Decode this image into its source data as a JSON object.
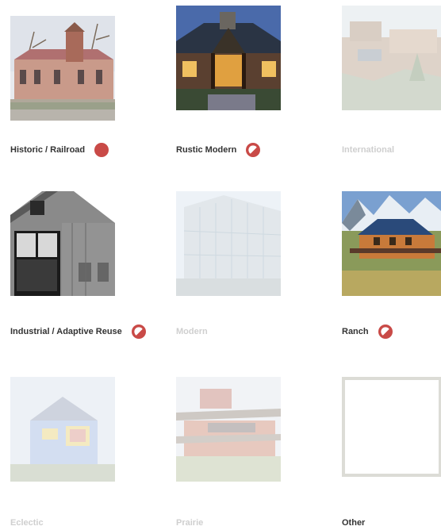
{
  "categories": [
    {
      "label": "Historic / Railroad",
      "state": "full",
      "icon": "filled-circle-icon",
      "image": "historic-railroad-building"
    },
    {
      "label": "Rustic Modern",
      "state": "partial",
      "icon": "half-circle-icon",
      "image": "rustic-lodge-entry"
    },
    {
      "label": "International",
      "state": "none",
      "icon": "",
      "image": "international-building"
    },
    {
      "label": "Industrial / Adaptive Reuse",
      "state": "partial",
      "icon": "half-circle-icon",
      "image": "industrial-barn"
    },
    {
      "label": "Modern",
      "state": "none",
      "icon": "",
      "image": "modern-glass-building"
    },
    {
      "label": "Ranch",
      "state": "partial",
      "icon": "half-circle-icon",
      "image": "ranch-house-mountains"
    },
    {
      "label": "Eclectic",
      "state": "none",
      "icon": "",
      "image": "eclectic-round-house"
    },
    {
      "label": "Prairie",
      "state": "none",
      "icon": "",
      "image": "prairie-style-house"
    },
    {
      "label": "Other",
      "state": "none",
      "icon": "",
      "image": "empty-frame"
    }
  ],
  "colors": {
    "accent": "#c94a47",
    "dim_text": "#cfcfcf",
    "text": "#333333"
  }
}
